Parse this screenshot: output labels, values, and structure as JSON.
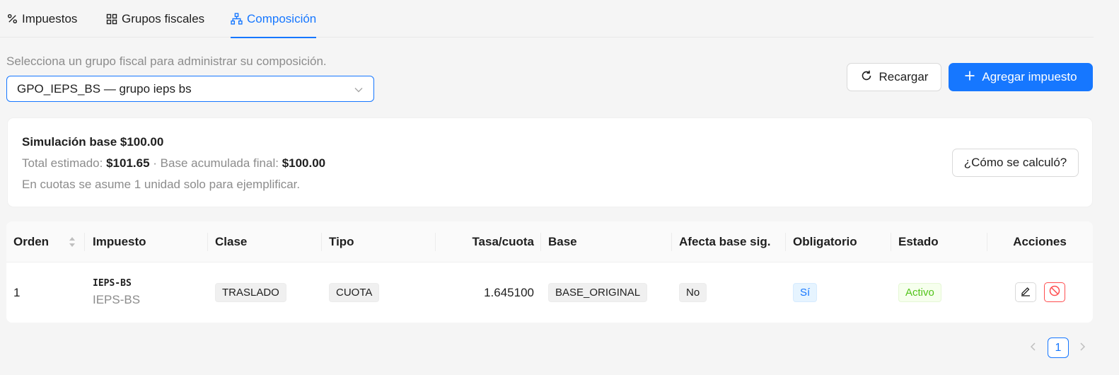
{
  "tabs": [
    {
      "label": "Impuestos",
      "icon": "percent-icon",
      "active": false
    },
    {
      "label": "Grupos fiscales",
      "icon": "grid-icon",
      "active": false
    },
    {
      "label": "Composición",
      "icon": "hierarchy-icon",
      "active": true
    }
  ],
  "selector": {
    "hint": "Selecciona un grupo fiscal para administrar su composición.",
    "value": "GPO_IEPS_BS — grupo ieps bs"
  },
  "actions": {
    "reload_label": "Recargar",
    "add_label": "Agregar impuesto"
  },
  "simulation": {
    "title": "Simulación base $100.00",
    "total_label": "Total estimado:",
    "total_value": "$101.65",
    "separator": "·",
    "base_label": "Base acumulada final:",
    "base_value": "$100.00",
    "note": "En cuotas se asume 1 unidad solo para ejemplificar.",
    "how_button": "¿Cómo se calculó?"
  },
  "table": {
    "columns": [
      "Orden",
      "Impuesto",
      "Clase",
      "Tipo",
      "Tasa/cuota",
      "Base",
      "Afecta base sig.",
      "Obligatorio",
      "Estado",
      "Acciones"
    ],
    "rows": [
      {
        "orden": "1",
        "impuesto_code": "IEPS-BS",
        "impuesto_name": "IEPS-BS",
        "clase": "TRASLADO",
        "tipo": "CUOTA",
        "tasa": "1.645100",
        "base": "BASE_ORIGINAL",
        "afecta": "No",
        "obligatorio": "Sí",
        "estado": "Activo"
      }
    ]
  },
  "pagination": {
    "current_page": "1"
  },
  "colors": {
    "primary": "#1677ff",
    "danger": "#ff4d4f",
    "success": "#52c41a"
  }
}
